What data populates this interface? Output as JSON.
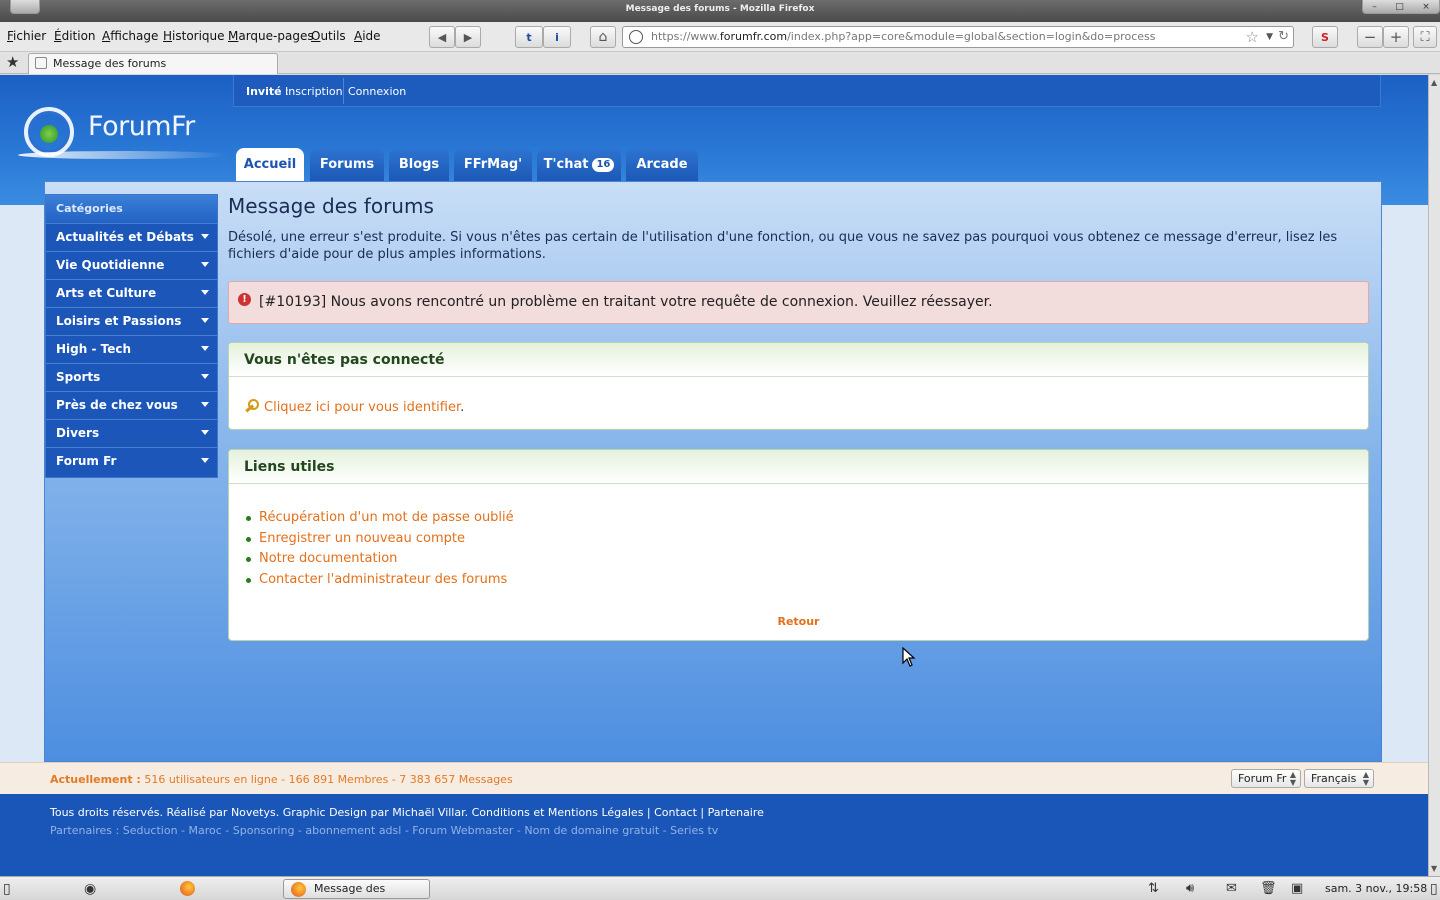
{
  "window": {
    "title": "Message des forums - Mozilla Firefox"
  },
  "menubar": {
    "items": [
      {
        "label": "Fichier",
        "accel": "F",
        "rest": "ichier"
      },
      {
        "label": "Édition",
        "accel": "É",
        "rest": "dition"
      },
      {
        "label": "Affichage",
        "accel": "A",
        "rest": "ffichage"
      },
      {
        "label": "Historique",
        "accel": "H",
        "rest": "istorique"
      },
      {
        "label": "Marque-pages",
        "accel": "M",
        "rest": "arque-pages"
      },
      {
        "label": "Outils",
        "accel": "O",
        "rest": "utils"
      },
      {
        "label": "Aide",
        "accel": "A",
        "rest": "ide"
      }
    ]
  },
  "urlbar": {
    "prefix": "https://www.",
    "domain": "forumfr.com",
    "path": "/index.php?app=core&module=global&section=login&do=process"
  },
  "tab": {
    "label": "Message des forums"
  },
  "site": {
    "logo_text": "ForumFr",
    "userbar": {
      "guest": "Invité",
      "separator": " : ",
      "register": "Inscription",
      "login": "Connexion"
    },
    "nav_tabs": [
      {
        "label": "Accueil",
        "active": true
      },
      {
        "label": "Forums",
        "active": false
      },
      {
        "label": "Blogs",
        "active": false
      },
      {
        "label": "FFrMag'",
        "active": false
      },
      {
        "label": "T'chat",
        "badge": "16",
        "active": false
      },
      {
        "label": "Arcade",
        "active": false
      }
    ],
    "sidebar": {
      "title": "Catégories",
      "items": [
        "Actualités et Débats",
        "Vie Quotidienne",
        "Arts et Culture",
        "Loisirs et Passions",
        "High - Tech",
        "Sports",
        "Près de chez vous",
        "Divers",
        "Forum Fr"
      ]
    },
    "content": {
      "title": "Message des forums",
      "intro": "Désolé, une erreur s'est produite. Si vous n'êtes pas certain de l'utilisation d'une fonction, ou que vous ne savez pas pourquoi vous obtenez ce message d'erreur, lisez les fichiers d'aide pour de plus amples informations.",
      "error": "[#10193] Nous avons rencontré un problème en traitant votre requête de connexion. Veuillez réessayer.",
      "login_panel": {
        "title": "Vous n'êtes pas connecté",
        "link": "Cliquez ici pour vous identifier",
        "suffix": "."
      },
      "links_panel": {
        "title": "Liens utiles",
        "links": [
          "Récupération d'un mot de passe oublié",
          "Enregistrer un nouveau compte",
          "Notre documentation",
          "Contacter l'administrateur des forums"
        ],
        "back": "Retour"
      }
    },
    "stats": {
      "label": "Actuellement :",
      "text": "516 utilisateurs en ligne - 166 891 Membres - 7 383 657 Messages"
    },
    "selects": {
      "skin": "Forum Fr",
      "language": "Français"
    },
    "footer": {
      "line1": "Tous droits réservés. Réalisé par Novetys. Graphic Design par Michaël Villar. Conditions et Mentions Légales | Contact | Partenaire",
      "line2": "Partenaires : Seduction - Maroc - Sponsoring - abonnement adsl - Forum Webmaster - Nom de domaine gratuit - Series tv"
    }
  },
  "taskbar": {
    "task_label": "Message des forums...",
    "clock": "sam. 3 nov., 19:58"
  },
  "colors": {
    "brand_blue": "#1b56b8",
    "link_orange": "#e3701a",
    "error_bg": "#f2dcdc",
    "panel_header_green": "#e4f1dc"
  }
}
